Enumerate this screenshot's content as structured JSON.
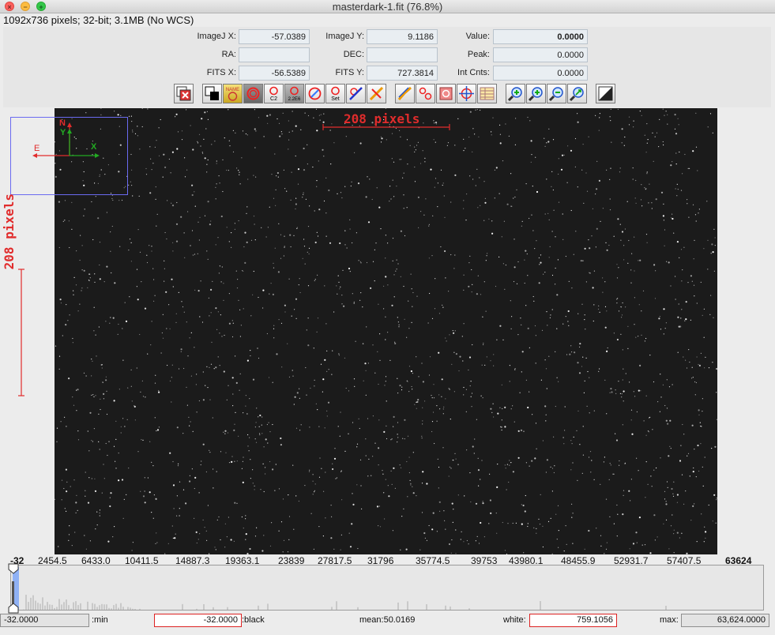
{
  "window": {
    "title": "masterdark-1.fit (76.8%)",
    "subtitle": "1092x736 pixels; 32-bit; 3.1MB (No WCS)"
  },
  "info": {
    "imagej_x_label": "ImageJ X:",
    "imagej_x": "-57.0389",
    "imagej_y_label": "ImageJ Y:",
    "imagej_y": "9.1186",
    "value_label": "Value:",
    "value": "0.0000",
    "ra_label": "RA:",
    "ra": "",
    "dec_label": "DEC:",
    "dec": "",
    "peak_label": "Peak:",
    "peak": "0.0000",
    "fits_x_label": "FITS X:",
    "fits_x": "-56.5389",
    "fits_y_label": "FITS Y:",
    "fits_y": "727.3814",
    "int_cnts_label": "Int Cnts:",
    "int_cnts": "0.0000"
  },
  "toolbar": {
    "buttons": [
      {
        "name": "clear-overlay-icon",
        "text": ""
      },
      {
        "name": "invert-icon",
        "text": ""
      },
      {
        "name": "name-aperture-icon",
        "text": "NAME"
      },
      {
        "name": "single-aperture-icon",
        "text": ""
      },
      {
        "name": "c2-aperture-icon",
        "text": "C2"
      },
      {
        "name": "ratio-aperture-icon",
        "text": "2.2E6"
      },
      {
        "name": "clear-apertures-icon",
        "text": ""
      },
      {
        "name": "set-aperture-icon",
        "text": "Set"
      },
      {
        "name": "measure-icon",
        "text": ""
      },
      {
        "name": "clear-measure-icon",
        "text": ""
      },
      {
        "name": "seeing-profile-icon",
        "text": ""
      },
      {
        "name": "multi-aperture-icon",
        "text": ""
      },
      {
        "name": "clear-multi-icon",
        "text": ""
      },
      {
        "name": "align-icon",
        "text": ""
      },
      {
        "name": "table-icon",
        "text": ""
      },
      {
        "name": "zoom-in-fit-icon",
        "text": ""
      },
      {
        "name": "zoom-in-icon",
        "text": ""
      },
      {
        "name": "zoom-out-icon",
        "text": ""
      },
      {
        "name": "zoom-fit-icon",
        "text": ""
      },
      {
        "name": "contrast-icon",
        "text": ""
      }
    ]
  },
  "overlay": {
    "scale_h": "208 pixels",
    "scale_v": "208 pixels",
    "north_label": "N",
    "east_label": "E",
    "x_label": "X",
    "y_label": "Y"
  },
  "histogram": {
    "ticks": [
      "-32",
      "2454.5",
      "6433.0",
      "10411.5",
      "14887.3",
      "19363.1",
      "23839",
      "27817.5",
      "31796",
      "35774.5",
      "39753",
      "43980.1",
      "48455.9",
      "52931.7",
      "57407.5",
      "63624"
    ]
  },
  "bottom": {
    "min_value": "-32.0000",
    "min_label": ":min",
    "black_value": "-32.0000",
    "black_label": ":black",
    "mean_text": "mean:50.0169",
    "white_label": "white:",
    "white_value": "759.1056",
    "max_label": "max:",
    "max_value": "63,624.0000"
  },
  "colors": {
    "overlay_red": "#e12c2c",
    "overlay_green": "#22aa22",
    "wcs_box": "#6a6af0",
    "hist_blue": "#8fb1f5"
  }
}
